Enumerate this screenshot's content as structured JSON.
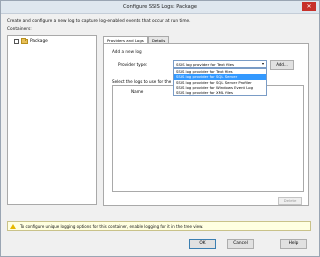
{
  "window": {
    "title": "Configure SSIS Logs: Package"
  },
  "description": "Create and configure a new log to capture log-enabled events that occur at run time.",
  "containers_label": "Containers:",
  "tree": {
    "items": [
      {
        "label": "Package",
        "checked": false,
        "icon": "folder-icon"
      }
    ]
  },
  "tabs": [
    {
      "label": "Providers and Logs"
    },
    {
      "label": "Details"
    }
  ],
  "providers": {
    "add_log_label": "Add a new log",
    "provider_type_label": "Provider type:",
    "selected": "SSIS log provider for Text files",
    "add_button": "Add...",
    "options": [
      "SSIS log provider for Text files",
      "SSIS log provider for SQL Server",
      "SSIS log provider for SQL Server Profiler",
      "SSIS log provider for Windows Event Log",
      "SSIS log provider for XML files"
    ],
    "highlighted_index": 1,
    "select_logs_label": "Select the logs to use for the container:",
    "name_header": "Name",
    "delete_button": "Delete"
  },
  "info_message": "To configure unique logging options for this container, enable logging for it in the tree view.",
  "buttons": {
    "ok": "OK",
    "cancel": "Cancel",
    "help": "Help"
  }
}
